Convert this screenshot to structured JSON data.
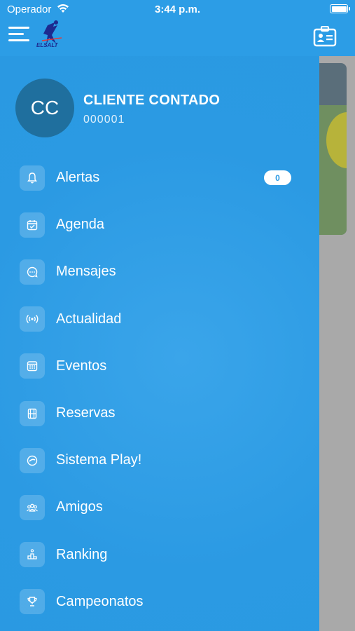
{
  "status_bar": {
    "carrier": "Operador",
    "time": "3:44 p.m.",
    "battery_level": 1.0
  },
  "header": {
    "logo_text": "ELSALT",
    "menu_icon": "hamburger-icon",
    "card_icon": "contact-card-icon"
  },
  "user": {
    "initials": "CC",
    "name": "CLIENTE CONTADO",
    "code": "000001"
  },
  "menu": [
    {
      "label": "Alertas",
      "icon": "bell-icon",
      "badge": "0"
    },
    {
      "label": "Agenda",
      "icon": "calendar-check-icon"
    },
    {
      "label": "Mensajes",
      "icon": "chat-bubble-icon"
    },
    {
      "label": "Actualidad",
      "icon": "broadcast-icon"
    },
    {
      "label": "Eventos",
      "icon": "calendar-grid-icon"
    },
    {
      "label": "Reservas",
      "icon": "court-icon"
    },
    {
      "label": "Sistema Play!",
      "icon": "play-badge-icon"
    },
    {
      "label": "Amigos",
      "icon": "friends-icon"
    },
    {
      "label": "Ranking",
      "icon": "podium-icon"
    },
    {
      "label": "Campeonatos",
      "icon": "trophy-icon"
    }
  ],
  "colors": {
    "primary": "#2b9be4",
    "avatar": "#1f6f9e",
    "overlay": "#a9a9a9"
  }
}
